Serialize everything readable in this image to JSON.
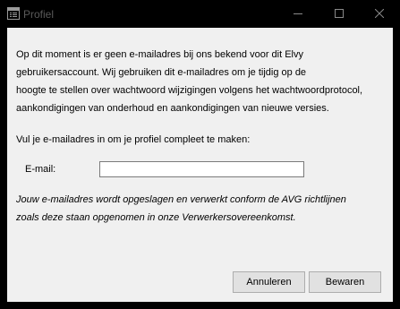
{
  "window": {
    "title": "Profiel",
    "icons": {
      "app": "window-form-icon",
      "minimize": "minimize-icon",
      "maximize": "maximize-icon",
      "close": "close-icon"
    },
    "colors": {
      "frame": "#000000",
      "client": "#f0f0f0",
      "title_text": "#5a5a5a"
    }
  },
  "form": {
    "intro_lines": [
      "Op dit moment is er geen e-mailadres bij ons bekend voor dit Elvy",
      "gebruikersaccount. Wij gebruiken dit e-mailadres om je tijdig op de",
      "hoogte te stellen over wachtwoord wijzigingen volgens het wachtwoordprotocol,",
      "aankondigingen van onderhoud en aankondigingen van nieuwe versies."
    ],
    "prompt": "Vul je e-mailadres in om je profiel compleet te maken:",
    "email_label": "E-mail:",
    "email_value": "",
    "privacy_lines": [
      "Jouw e-mailadres wordt opgeslagen en verwerkt conform de AVG richtlijnen",
      "zoals deze staan opgenomen in onze Verwerkersovereenkomst."
    ]
  },
  "buttons": {
    "cancel": "Annuleren",
    "save": "Bewaren"
  }
}
